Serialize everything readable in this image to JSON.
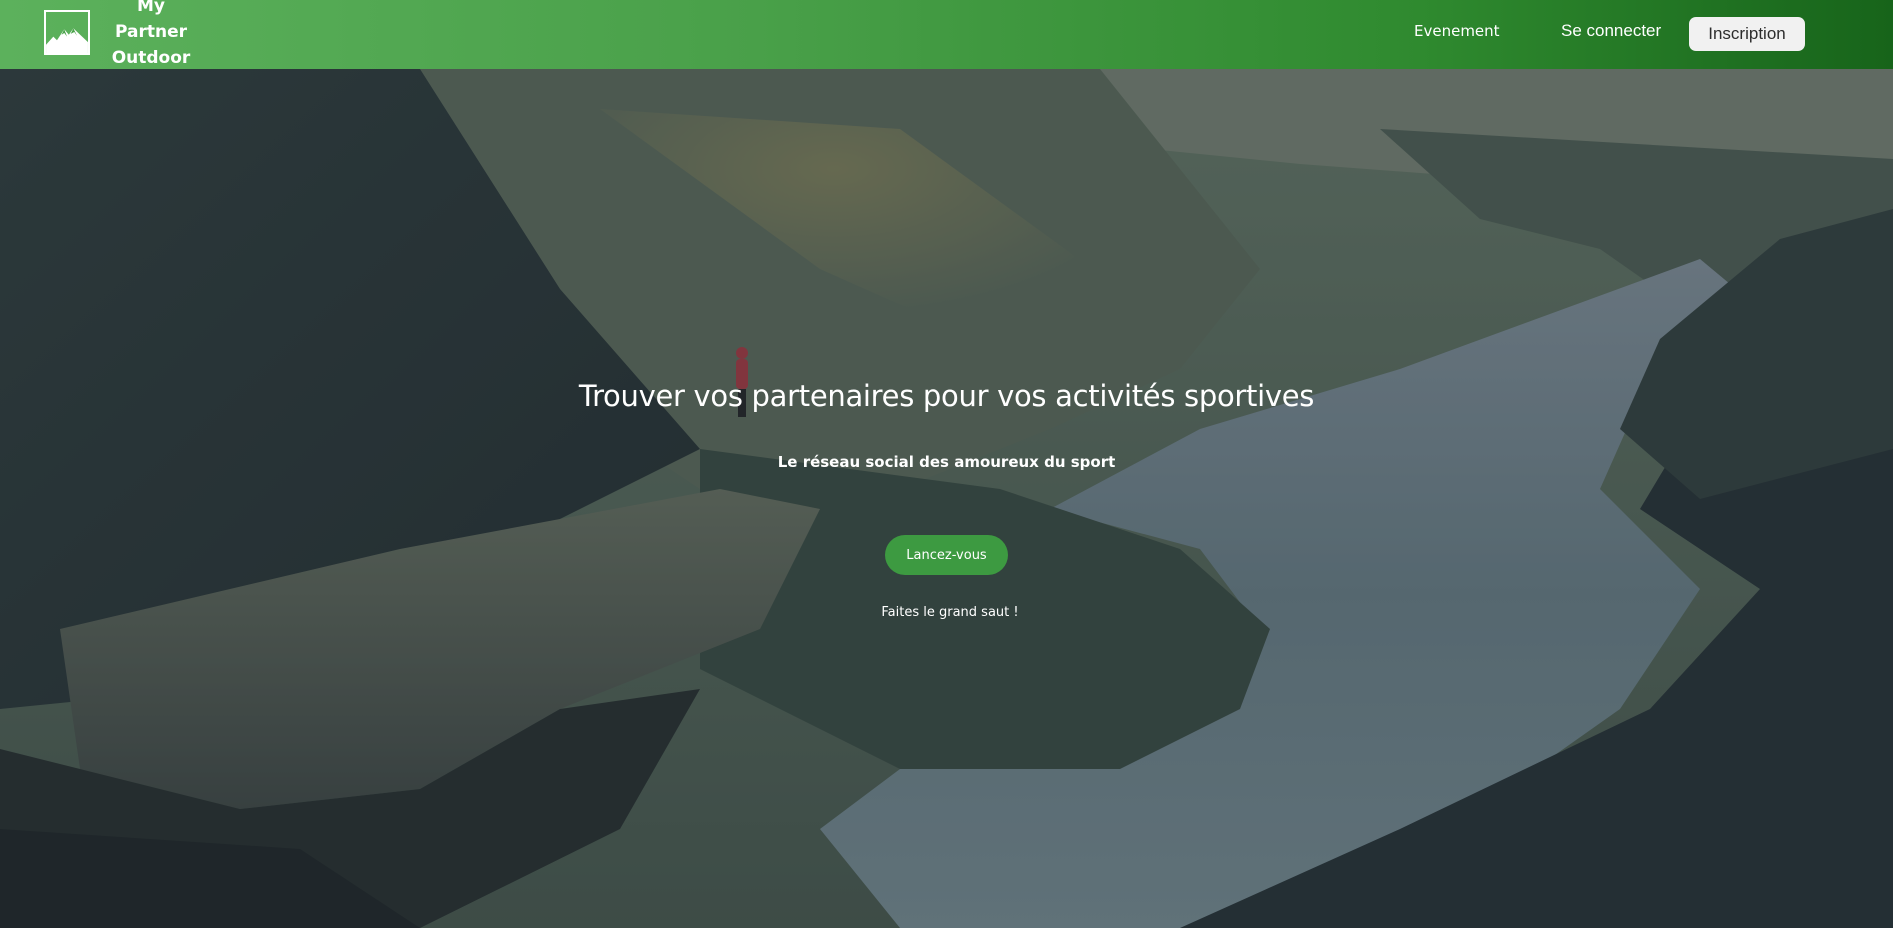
{
  "brand": {
    "logo_icon": "mountain-logo-icon",
    "name_line1": "My Partner",
    "name_line2": "Outdoor"
  },
  "nav": {
    "events_label": "Evenement",
    "login_label": "Se connecter",
    "signup_label": "Inscription"
  },
  "hero": {
    "background": "mountain-fjord-photo",
    "title": "Trouver vos partenaires pour vos activités sportives",
    "subtitle": "Le réseau social des amoureux du sport",
    "cta_label": "Lancez-vous",
    "tagline": "Faites le grand saut !"
  },
  "colors": {
    "navbar_gradient_start": "#5cb15c",
    "navbar_gradient_end": "#17641a",
    "cta_background": "#3d9a41",
    "signup_background": "#f1f1f1",
    "text_light": "#ffffff"
  }
}
